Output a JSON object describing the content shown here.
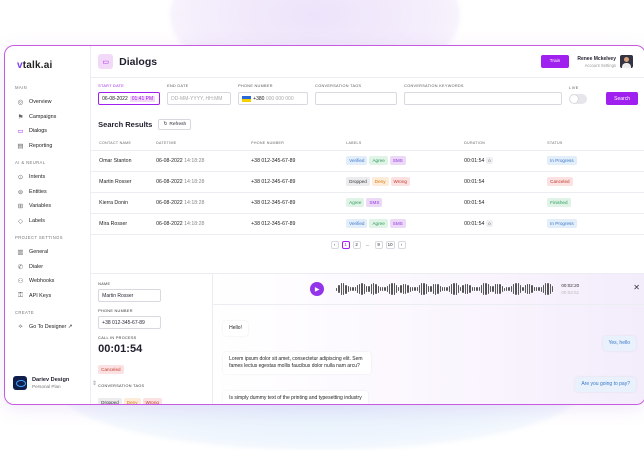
{
  "app": {
    "logo_prefix": "v",
    "logo_rest": "talk.ai"
  },
  "sidebar": {
    "sections": [
      {
        "title": "MAIN",
        "items": [
          {
            "label": "Overview",
            "icon": "compass-icon",
            "glyph": "◎"
          },
          {
            "label": "Campaigns",
            "icon": "megaphone-icon",
            "glyph": "⚑"
          },
          {
            "label": "Dialogs",
            "icon": "chat-icon",
            "glyph": "▭",
            "active": true
          },
          {
            "label": "Reporting",
            "icon": "report-icon",
            "glyph": "▤"
          }
        ]
      },
      {
        "title": "AI & NEURAL",
        "items": [
          {
            "label": "Intents",
            "icon": "intents-icon",
            "glyph": "⊙"
          },
          {
            "label": "Entities",
            "icon": "entities-icon",
            "glyph": "⊚"
          },
          {
            "label": "Variables",
            "icon": "variables-icon",
            "glyph": "⊞"
          },
          {
            "label": "Labels",
            "icon": "tag-icon",
            "glyph": "◇"
          }
        ]
      },
      {
        "title": "PROJECT SETTINGS",
        "items": [
          {
            "label": "General",
            "icon": "chart-icon",
            "glyph": "▥"
          },
          {
            "label": "Dialer",
            "icon": "phone-icon",
            "glyph": "✆"
          },
          {
            "label": "Webhooks",
            "icon": "webhook-icon",
            "glyph": "⚇"
          },
          {
            "label": "API Keys",
            "icon": "key-icon",
            "glyph": "⚿"
          }
        ]
      },
      {
        "title": "CREATE",
        "items": [
          {
            "label": "Go To Designer ↗",
            "icon": "designer-icon",
            "glyph": "⟡"
          }
        ]
      }
    ],
    "user": {
      "name": "Dariev Design",
      "plan": "Personal Plan"
    }
  },
  "header": {
    "title": "Dialogs",
    "train_label": "Train",
    "account_name": "Renee Mckelvey",
    "account_sub": "Account Settings"
  },
  "filters": {
    "start_date_label": "START DATE",
    "start_date_value": "06-08-2022",
    "start_time_value": "01:41 PM",
    "end_date_label": "END DATE",
    "end_date_placeholder": "DD-MM-YYYY, HH:MM",
    "phone_label": "PHONE NUMBER",
    "phone_code": "+380",
    "phone_placeholder": "000 000 000",
    "tags_label": "CONVERSATION TAGS",
    "keywords_label": "CONVERSATION KEYWORDS",
    "live_label": "LIVE",
    "search_label": "Search"
  },
  "results": {
    "title": "Search Results",
    "refresh_label": "Refresh",
    "columns": [
      "CONTACT NAME",
      "DATETIME",
      "PHONE NUMBER",
      "LABELS",
      "DURATION",
      "STATUS"
    ],
    "rows": [
      {
        "name": "Omar Stanton",
        "date": "06-08-2022",
        "time": "14:18:28",
        "phone": "+38 012-345-67-89",
        "labels": [
          [
            "Verified",
            "verified"
          ],
          [
            "Agree",
            "agree"
          ],
          [
            "SMS",
            "sms"
          ]
        ],
        "duration": "00:01:54",
        "badge": "0",
        "status": [
          "In Progress",
          "inprog"
        ]
      },
      {
        "name": "Martin Rosser",
        "date": "06-08-2022",
        "time": "14:18:28",
        "phone": "+38 012-345-67-89",
        "labels": [
          [
            "Dropped",
            "dropped"
          ],
          [
            "Deny",
            "deny"
          ],
          [
            "Wrong",
            "wrong"
          ]
        ],
        "duration": "00:01:54",
        "badge": "",
        "status": [
          "Canceled",
          "canceled"
        ]
      },
      {
        "name": "Kierra Donin",
        "date": "06-08-2022",
        "time": "14:18:28",
        "phone": "+38 012-345-67-89",
        "labels": [
          [
            "Agree",
            "agree"
          ],
          [
            "SMS",
            "sms"
          ]
        ],
        "duration": "00:01:54",
        "badge": "",
        "status": [
          "Finished",
          "finished"
        ]
      },
      {
        "name": "Mira Rosser",
        "date": "06-08-2022",
        "time": "14:18:28",
        "phone": "+38 012-345-67-89",
        "labels": [
          [
            "Verified",
            "verified"
          ],
          [
            "Agree",
            "agree"
          ],
          [
            "SMS",
            "sms"
          ]
        ],
        "duration": "00:01:54",
        "badge": "0",
        "status": [
          "In Progress",
          "inprog"
        ]
      }
    ],
    "pages": [
      "‹",
      "1",
      "2",
      "...",
      "9",
      "10",
      "›"
    ],
    "current_page": "1"
  },
  "details": {
    "name_label": "NAME",
    "name_value": "Martin Rosser",
    "phone_label": "PHONE NUMBER",
    "phone_value": "+38 012-345-67-89",
    "call_label": "CALL IN PROCESS",
    "call_time": "00:01:54",
    "call_status": "Canceled",
    "tags_label": "CONVERSATION TAGS",
    "tags": [
      [
        "Dropped",
        "dropped"
      ],
      [
        "Deny",
        "deny"
      ],
      [
        "Wrong",
        "wrong"
      ]
    ]
  },
  "player": {
    "time_current": "00:02:20",
    "time_total": "00:04:51"
  },
  "messages": [
    {
      "text": "Hello!",
      "side": "left"
    },
    {
      "text": "Yes, hello",
      "side": "right"
    },
    {
      "text": "Lorem ipsum dolor sit amet, consectetur adipiscing elit. Sem fames lectus egestas mollis faucibus dolor nulla nam arcu?",
      "side": "left"
    },
    {
      "text": "Are you going to pay?",
      "side": "right"
    },
    {
      "text": "Is simply dummy text of the printing and typesetting industry",
      "side": "left"
    }
  ],
  "colors": {
    "accent": "#a020f0",
    "frame": "#c75be0"
  }
}
